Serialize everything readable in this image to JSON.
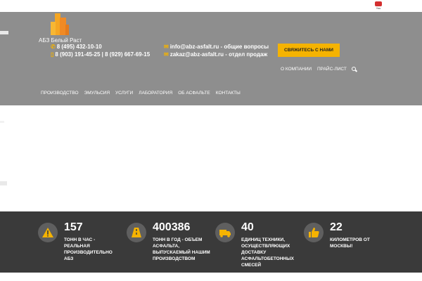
{
  "topbar": {
    "youtube_icon": "youtube-icon",
    "youtube_text": "You"
  },
  "header": {
    "brand_name": "АБЗ Белый Раст",
    "phone_1": "8 (495) 432-10-10",
    "phone_2": "8 (903) 191-45-25 | 8 (929) 667-69-15",
    "email_1": "info@abz-asfalt.ru - общие вопросы",
    "email_2": "zakaz@abz-asfalt.ru - отдел продаж",
    "cta_label": "СВЯЖИТЕСЬ С НАМИ",
    "subnav": [
      "О КОМПАНИИ",
      "ПРАЙС-ЛИСТ"
    ],
    "mainnav": [
      "ПРОИЗВОДСТВО",
      "ЭМУЛЬСИЯ",
      "УСЛУГИ",
      "ЛАБОРАТОРИЯ",
      "ОБ АСФАЛЬТЕ",
      "КОНТАКТЫ"
    ],
    "accent_color": "#f5b301"
  },
  "stats": [
    {
      "icon": "warning-icon",
      "number": "157",
      "label": "ТОНН В ЧАС - РЕАЛЬНАЯ ПРОИЗВОДИТЕЛЬНО АБЗ"
    },
    {
      "icon": "road-icon",
      "number": "400386",
      "label": "ТОНН В ГОД - ОБЪЕМ АСФАЛЬТА, ВЫПУСКАЕМЫЙ НАШИМ ПРОИЗВОДСТВОМ"
    },
    {
      "icon": "truck-icon",
      "number": "40",
      "label": "ЕДИНИЦ ТЕХНИКИ, ОСУЩЕСТВЛЯЮЩИХ ДОСТАВКУ АСФАЛЬТОБЕТОННЫХ СМЕСЕЙ"
    },
    {
      "icon": "thumbs-up-icon",
      "number": "22",
      "label": "КИЛОМЕТРОВ ОТ МОСКВЫ!"
    }
  ]
}
